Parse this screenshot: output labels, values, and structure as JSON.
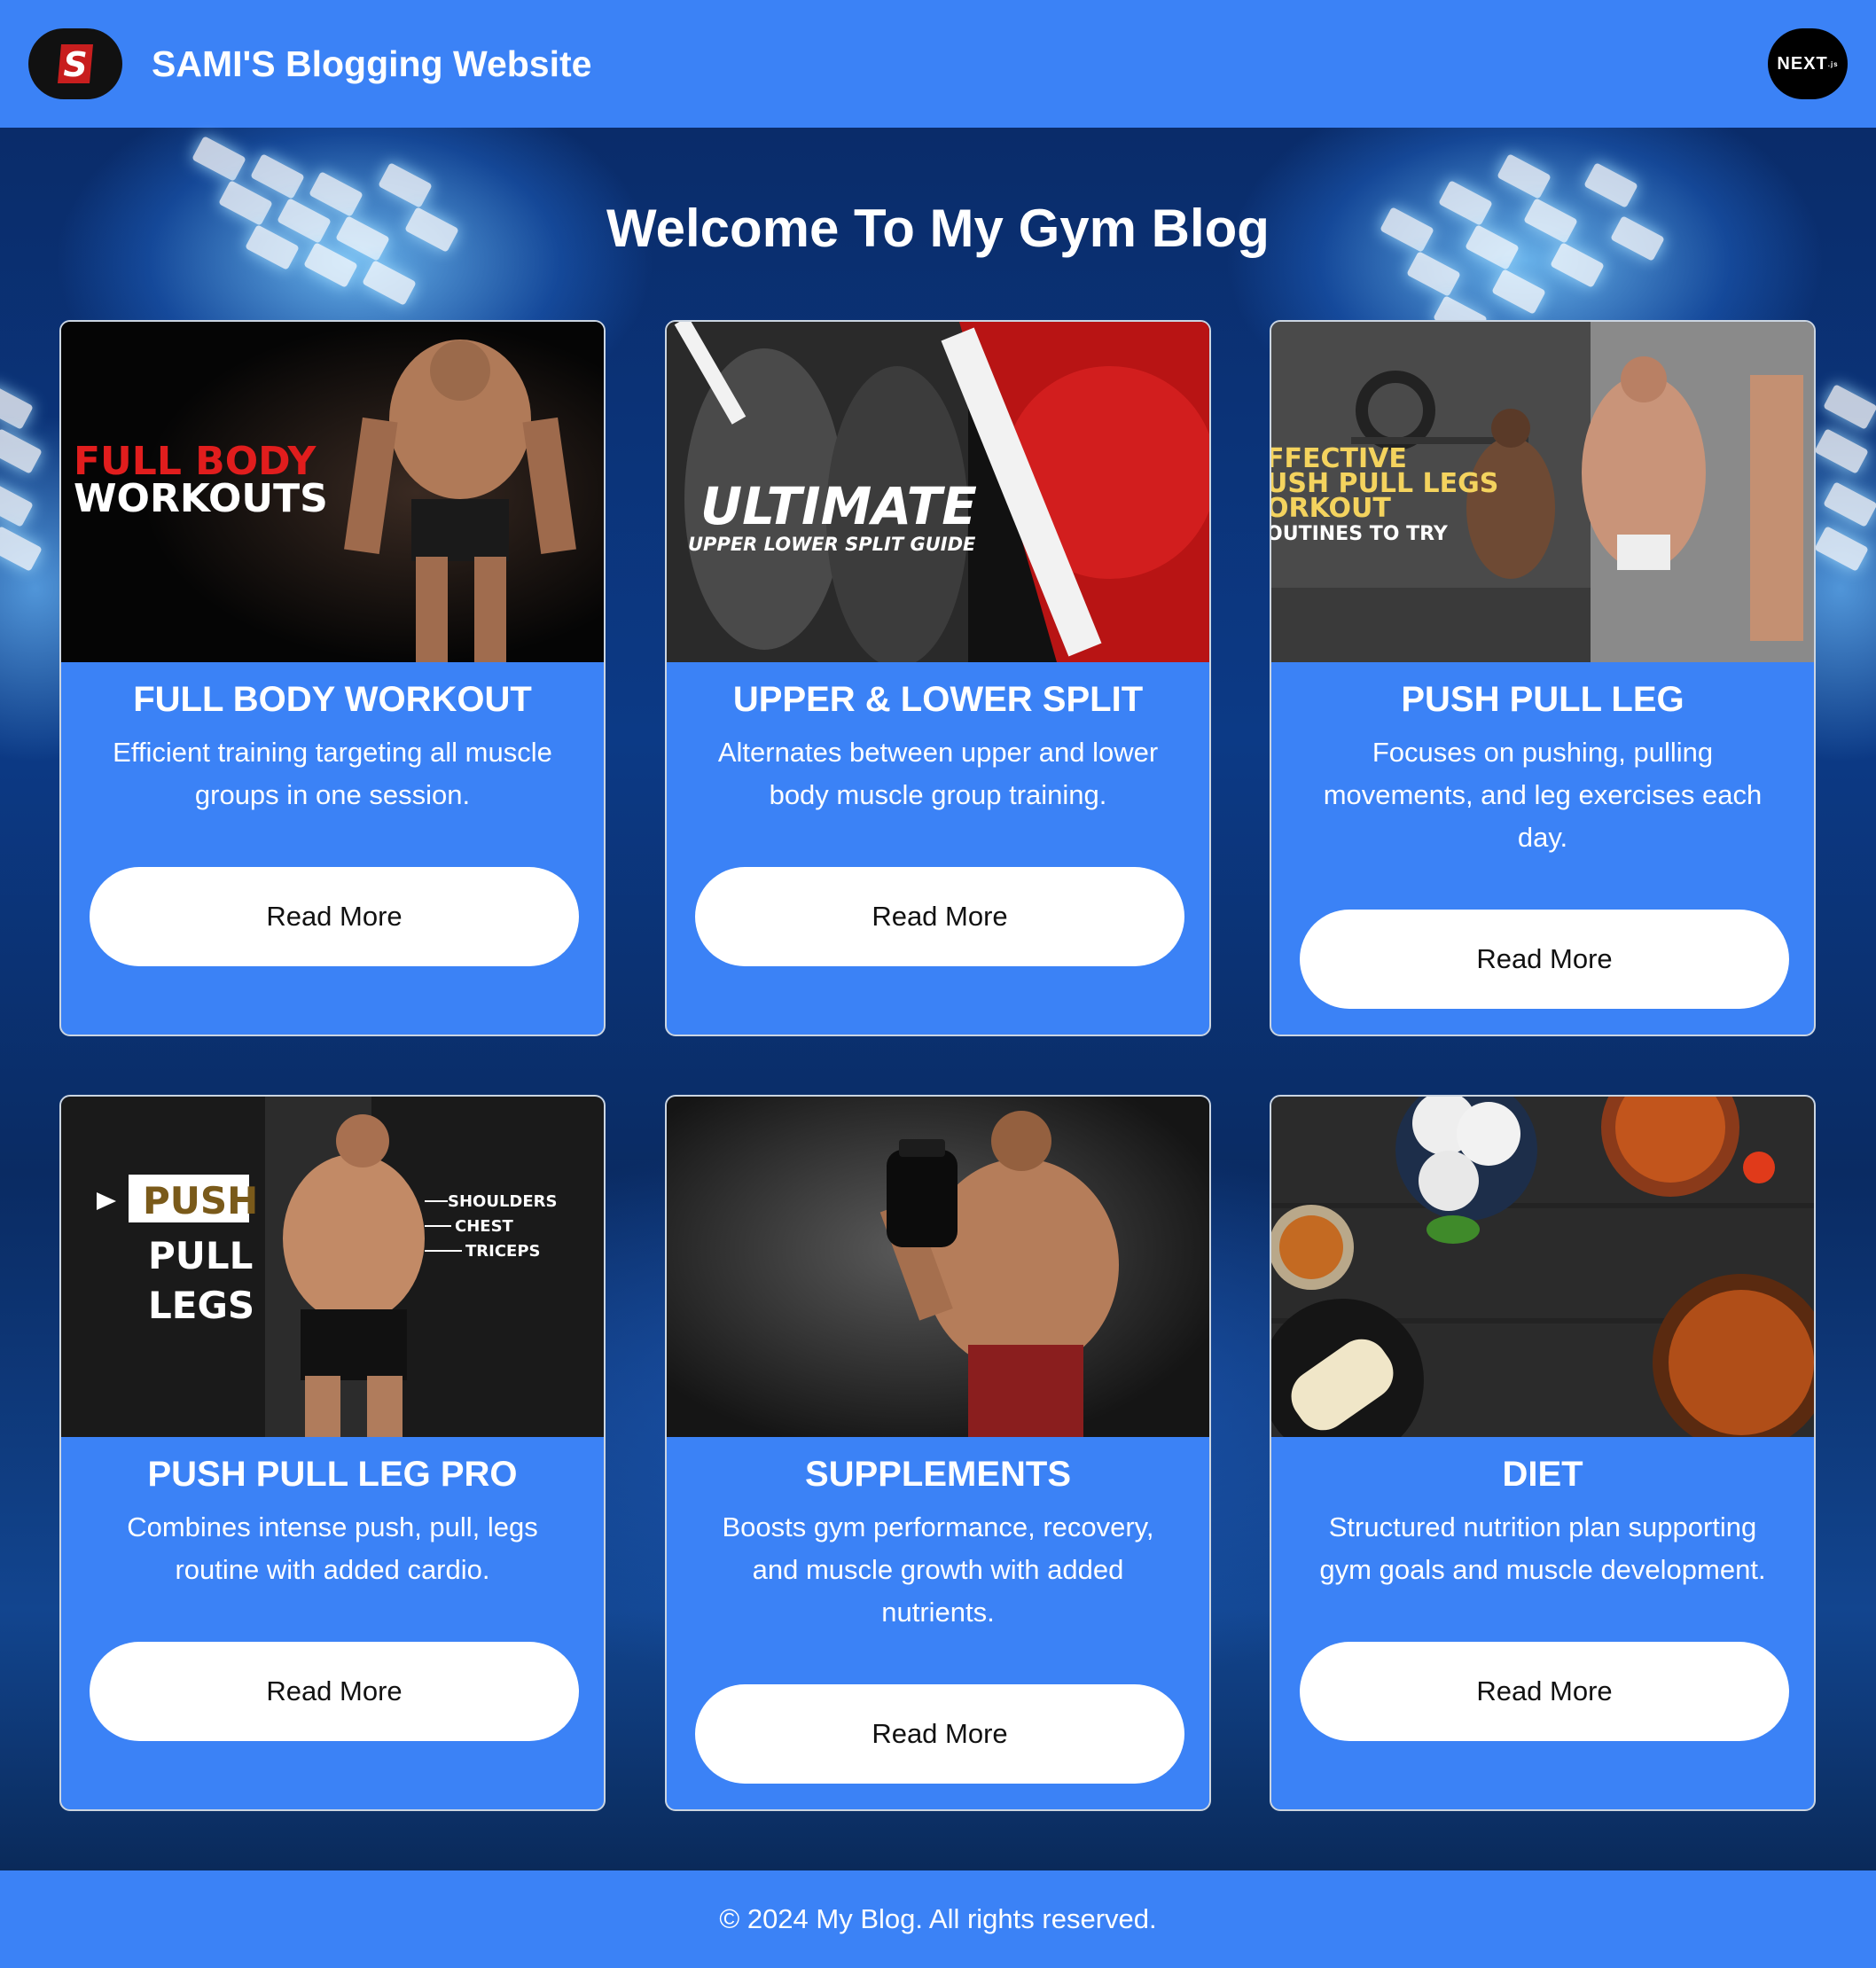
{
  "header": {
    "logo_letter": "S",
    "site_title": "SAMI'S Blogging Website",
    "badge_text": "NEXT",
    "badge_sub": ".js"
  },
  "hero": {
    "heading": "Welcome To My Gym Blog"
  },
  "posts": [
    {
      "title": "FULL BODY WORKOUT",
      "description": "Efficient training targeting all muscle groups in one session.",
      "button": "Read More",
      "image_text": [
        "FULL BODY",
        "WORKOUTS"
      ],
      "image_icon": "muscular-man-photo"
    },
    {
      "title": "UPPER & LOWER SPLIT",
      "description": "Alternates between upper and lower body muscle group training.",
      "button": "Read More",
      "image_text": [
        "ULTIMATE",
        "UPPER LOWER SPLIT GUIDE"
      ],
      "image_icon": "red-torso-legs-photo"
    },
    {
      "title": "PUSH PULL LEG",
      "description": "Focuses on pushing, pulling movements, and leg exercises each day.",
      "button": "Read More",
      "image_text": [
        "FFECTIVE",
        "USH PULL LEGS",
        "ORKOUT",
        "OUTINES TO TRY"
      ],
      "image_icon": "gym-athletes-photo"
    },
    {
      "title": "PUSH PULL LEG PRO",
      "description": "Combines intense push, pull, legs routine with added cardio.",
      "button": "Read More",
      "image_text": [
        "PUSH",
        "PULL",
        "LEGS",
        "SHOULDERS",
        "CHEST",
        "TRICEPS"
      ],
      "image_icon": "athlete-flexing-photo"
    },
    {
      "title": "SUPPLEMENTS",
      "description": "Boosts gym performance, recovery, and muscle growth with added nutrients.",
      "button": "Read More",
      "image_icon": "man-with-supplement-jar-photo"
    },
    {
      "title": "DIET",
      "description": "Structured nutrition plan supporting gym goals and muscle development.",
      "button": "Read More",
      "image_icon": "food-bowls-photo"
    }
  ],
  "footer": {
    "text": "© 2024 My Blog. All rights reserved."
  },
  "colors": {
    "primary": "#3b82f6",
    "button_bg": "#ffffff",
    "text": "#ffffff"
  }
}
